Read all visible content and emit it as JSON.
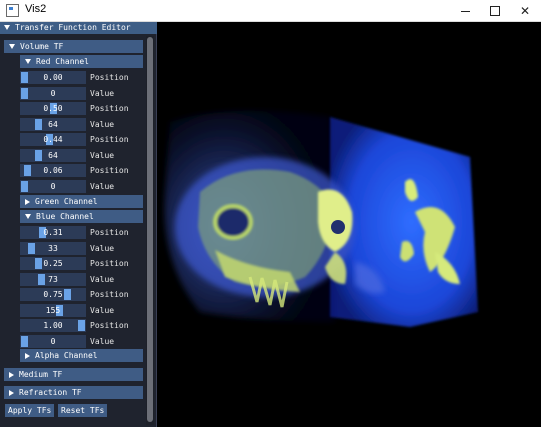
{
  "window": {
    "title": "Vis2"
  },
  "panel": {
    "title": "Transfer Function Editor",
    "volume_tf": "Volume TF",
    "red_channel": "Red Channel",
    "green_channel": "Green Channel",
    "blue_channel": "Blue Channel",
    "alpha_channel": "Alpha Channel",
    "medium_tf": "Medium TF",
    "refraction_tf": "Refraction TF",
    "apply_label": "Apply TFs",
    "reset_label": "Reset TFs",
    "red_rows": [
      {
        "value": "0.00",
        "label": "Position",
        "fraction": 0.0
      },
      {
        "value": "0",
        "label": "Value",
        "fraction": 0.0
      },
      {
        "value": "0.50",
        "label": "Position",
        "fraction": 0.5
      },
      {
        "value": "64",
        "label": "Value",
        "fraction": 0.25
      },
      {
        "value": "0.44",
        "label": "Position",
        "fraction": 0.44
      },
      {
        "value": "64",
        "label": "Value",
        "fraction": 0.25
      },
      {
        "value": "0.06",
        "label": "Position",
        "fraction": 0.06
      },
      {
        "value": "0",
        "label": "Value",
        "fraction": 0.0
      }
    ],
    "blue_rows": [
      {
        "value": "0.31",
        "label": "Position",
        "fraction": 0.31
      },
      {
        "value": "33",
        "label": "Value",
        "fraction": 0.13
      },
      {
        "value": "0.25",
        "label": "Position",
        "fraction": 0.25
      },
      {
        "value": "73",
        "label": "Value",
        "fraction": 0.29
      },
      {
        "value": "0.75",
        "label": "Position",
        "fraction": 0.75
      },
      {
        "value": "155",
        "label": "Value",
        "fraction": 0.61
      },
      {
        "value": "1.00",
        "label": "Position",
        "fraction": 1.0
      },
      {
        "value": "0",
        "label": "Value",
        "fraction": 0.0
      }
    ]
  }
}
